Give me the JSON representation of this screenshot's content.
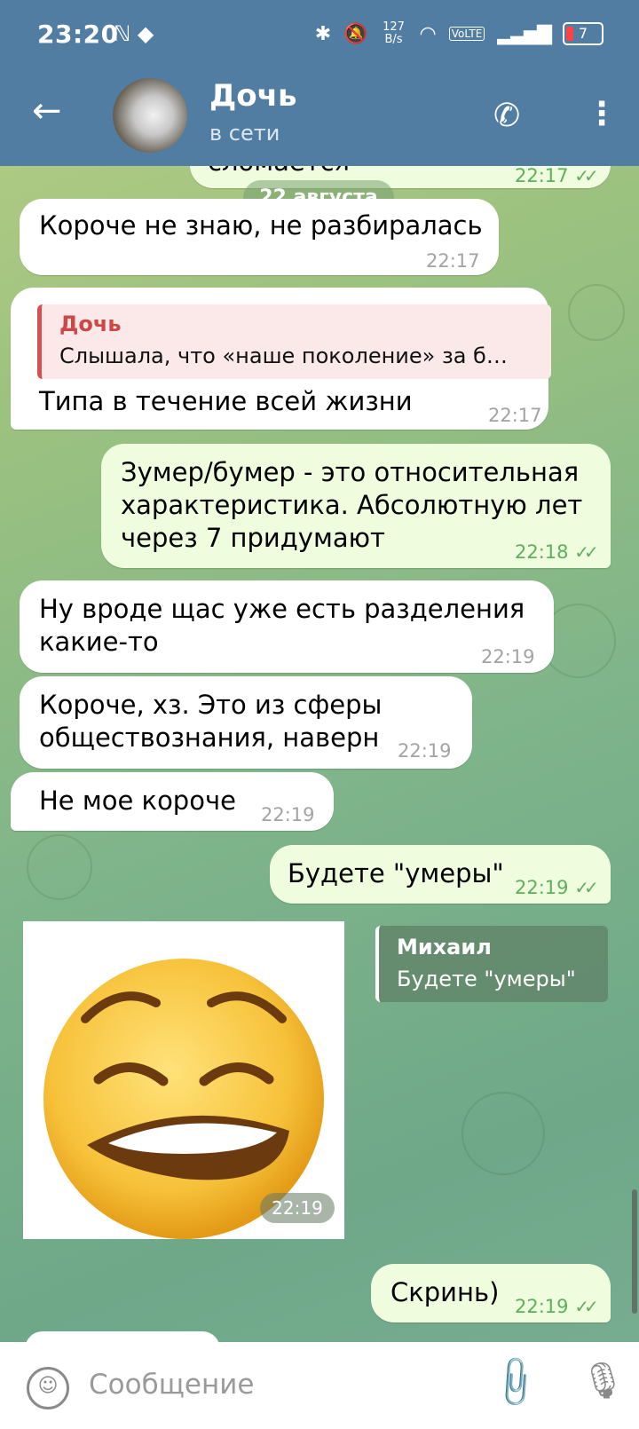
{
  "status_bar": {
    "time": "23:20",
    "left_icons": "ℕ ◆",
    "network_speed": "127 B/s",
    "volte": "VoLTE",
    "battery": "7"
  },
  "chat_header": {
    "name": "Дочь",
    "status": "в сети"
  },
  "date_separator": "22 августа",
  "messages": [
    {
      "dir": "in",
      "text": "Короче не знаю, не разбиралась",
      "time": "22:17"
    },
    {
      "dir": "in",
      "reply_author": "Дочь",
      "reply_text": "Слышала, что «наше поколение» за б…",
      "text": "Типа в течение всей жизни",
      "time": "22:17"
    },
    {
      "dir": "out",
      "text": "Зумер/бумер - это относительная характеристика. Абсолютную лет через 7 придумают",
      "time": "22:18",
      "read": true
    },
    {
      "dir": "in",
      "text": "Ну вроде щас уже есть разделения какие-то",
      "time": "22:19"
    },
    {
      "dir": "in",
      "text": "Короче, хз. Это из сферы обществознания, наверн",
      "time": "22:19"
    },
    {
      "dir": "in",
      "text": "Не мое короче",
      "time": "22:19"
    },
    {
      "dir": "out",
      "text": "Будете \"умеры\"",
      "time": "22:19",
      "read": true
    },
    {
      "dir": "in",
      "type": "sticker",
      "sticker_name": "weary-face-biting-lip-emoji",
      "reply_author": "Михаил",
      "reply_text": "Будете \"умеры\"",
      "time": "22:19"
    },
    {
      "dir": "out",
      "text": "Скринь)",
      "time": "22:19",
      "read": true
    }
  ],
  "top_partial_message": {
    "text": "сломается",
    "time": "22:17"
  },
  "input_bar": {
    "placeholder": "Сообщение",
    "emoji_icon": "emoji-icon",
    "attach_icon": "paperclip-icon",
    "mic_icon": "microphone-icon"
  }
}
